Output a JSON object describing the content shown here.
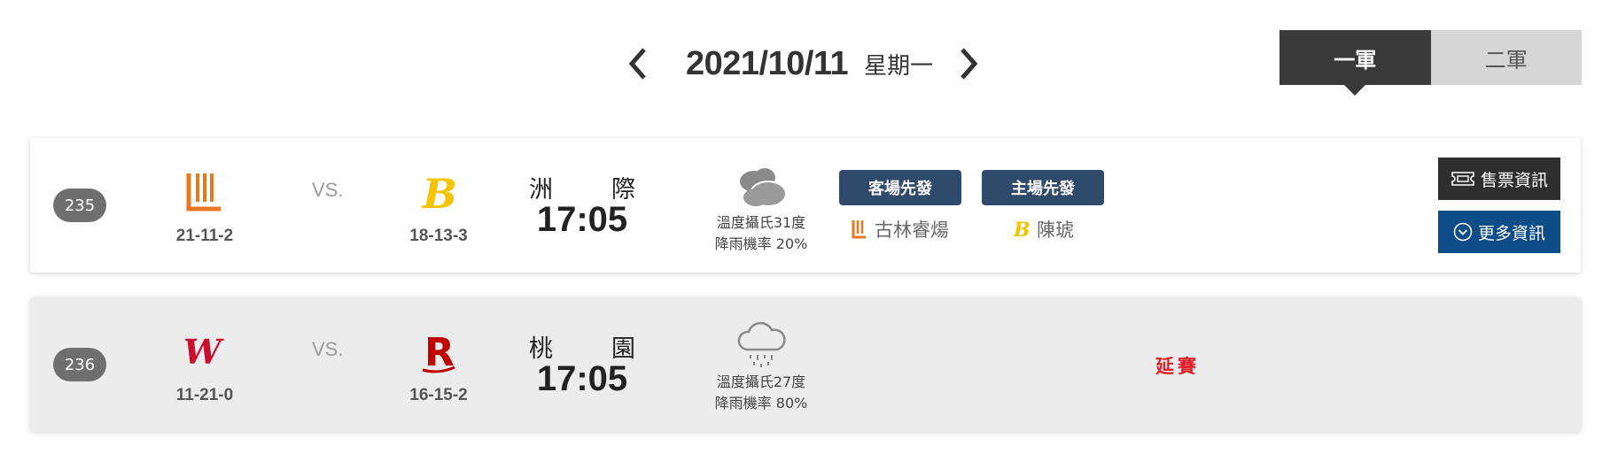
{
  "date_nav": {
    "date": "2021/10/11",
    "weekday": "星期一"
  },
  "league_tabs": [
    {
      "label": "一軍",
      "active": true
    },
    {
      "label": "二軍",
      "active": false
    }
  ],
  "games": [
    {
      "number": "235",
      "away": {
        "logo": "lamigo-monkeys-logo",
        "record": "21-11-2",
        "color": "#e87722"
      },
      "vs": "VS.",
      "home": {
        "logo": "brothers-logo",
        "record": "18-13-3",
        "color": "#f5c400"
      },
      "venue": [
        "洲",
        "際"
      ],
      "time": "17:05",
      "weather": {
        "icon": "cloudy-icon",
        "temp": "溫度攝氏31度",
        "rain": "降雨機率 20%"
      },
      "away_pitcher": {
        "badge": "客場先發",
        "name": "古林睿煬"
      },
      "home_pitcher": {
        "badge": "主場先發",
        "name": "陳琥"
      },
      "buttons": {
        "ticket": "售票資訊",
        "more": "更多資訊"
      }
    },
    {
      "number": "236",
      "away": {
        "logo": "wei-chuan-dragons-logo",
        "record": "11-21-0",
        "color": "#c8102e"
      },
      "vs": "VS.",
      "home": {
        "logo": "rakuten-monkeys-logo",
        "record": "16-15-2",
        "color": "#bf0000"
      },
      "venue": [
        "桃",
        "園"
      ],
      "time": "17:05",
      "weather": {
        "icon": "rain-icon",
        "temp": "溫度攝氏27度",
        "rain": "降雨機率 80%"
      },
      "status": "延賽"
    }
  ],
  "colors": {
    "tab_active": "#3a3a3a",
    "tab_inactive": "#d6d6d6",
    "pitcher_badge": "#2f4a6b",
    "ticket_button": "#2f2f2f",
    "more_button": "#0f4c8a",
    "postponed": "#e0202a"
  }
}
